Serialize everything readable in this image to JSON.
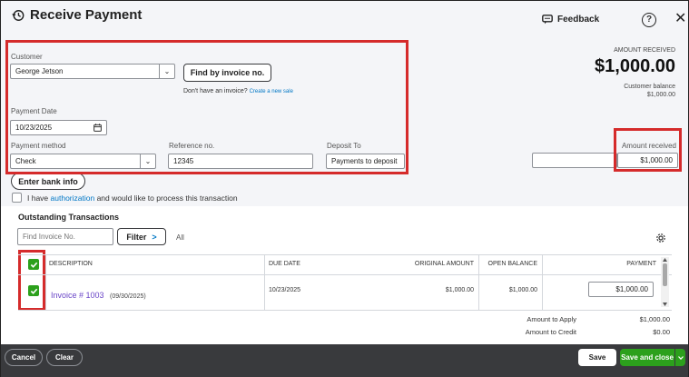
{
  "header": {
    "title": "Receive Payment",
    "feedback": "Feedback",
    "help": "?",
    "close": "✕"
  },
  "summary": {
    "amount_received_label": "AMOUNT RECEIVED",
    "amount_received_value": "$1,000.00",
    "customer_balance_label": "Customer balance",
    "customer_balance_value": "$1,000.00"
  },
  "form": {
    "customer_label": "Customer",
    "customer_value": "George Jetson",
    "find_invoice_button": "Find by invoice no.",
    "no_invoice_text": "Don't have an invoice?",
    "create_sale_link": "Create a new sale",
    "payment_date_label": "Payment Date",
    "payment_date_value": "10/23/2025",
    "payment_method_label": "Payment method",
    "payment_method_value": "Check",
    "reference_label": "Reference no.",
    "reference_value": "12345",
    "deposit_to_label": "Deposit To",
    "deposit_to_value": "Payments to deposit",
    "amount_received_label": "Amount received",
    "amount_received_value": "$1,000.00",
    "bank_info_button": "Enter bank info",
    "auth_text_pre": "I have",
    "auth_link": "authorization",
    "auth_text_post": "and would like to process this transaction"
  },
  "outstanding": {
    "heading": "Outstanding Transactions",
    "find_placeholder": "Find Invoice No.",
    "filter_button": "Filter",
    "filter_chevron": ">",
    "all_label": "All",
    "columns": {
      "description": "DESCRIPTION",
      "due_date": "DUE DATE",
      "original_amount": "ORIGINAL AMOUNT",
      "open_balance": "OPEN BALANCE",
      "payment": "PAYMENT"
    },
    "rows": [
      {
        "invoice": "Invoice # 1003",
        "invoice_date": "(09/30/2025)",
        "due_date": "10/23/2025",
        "original_amount": "$1,000.00",
        "open_balance": "$1,000.00",
        "payment": "$1,000.00"
      }
    ],
    "amount_to_apply_label": "Amount to Apply",
    "amount_to_apply_value": "$1,000.00",
    "amount_to_credit_label": "Amount to Credit",
    "amount_to_credit_value": "$0.00"
  },
  "footer": {
    "cancel": "Cancel",
    "clear": "Clear",
    "save": "Save",
    "save_and_close": "Save and close"
  },
  "colors": {
    "accent_green": "#2ca01c",
    "highlight_red": "#d52b2b",
    "link_blue": "#0077c5",
    "footer_bg": "#393a3d"
  }
}
